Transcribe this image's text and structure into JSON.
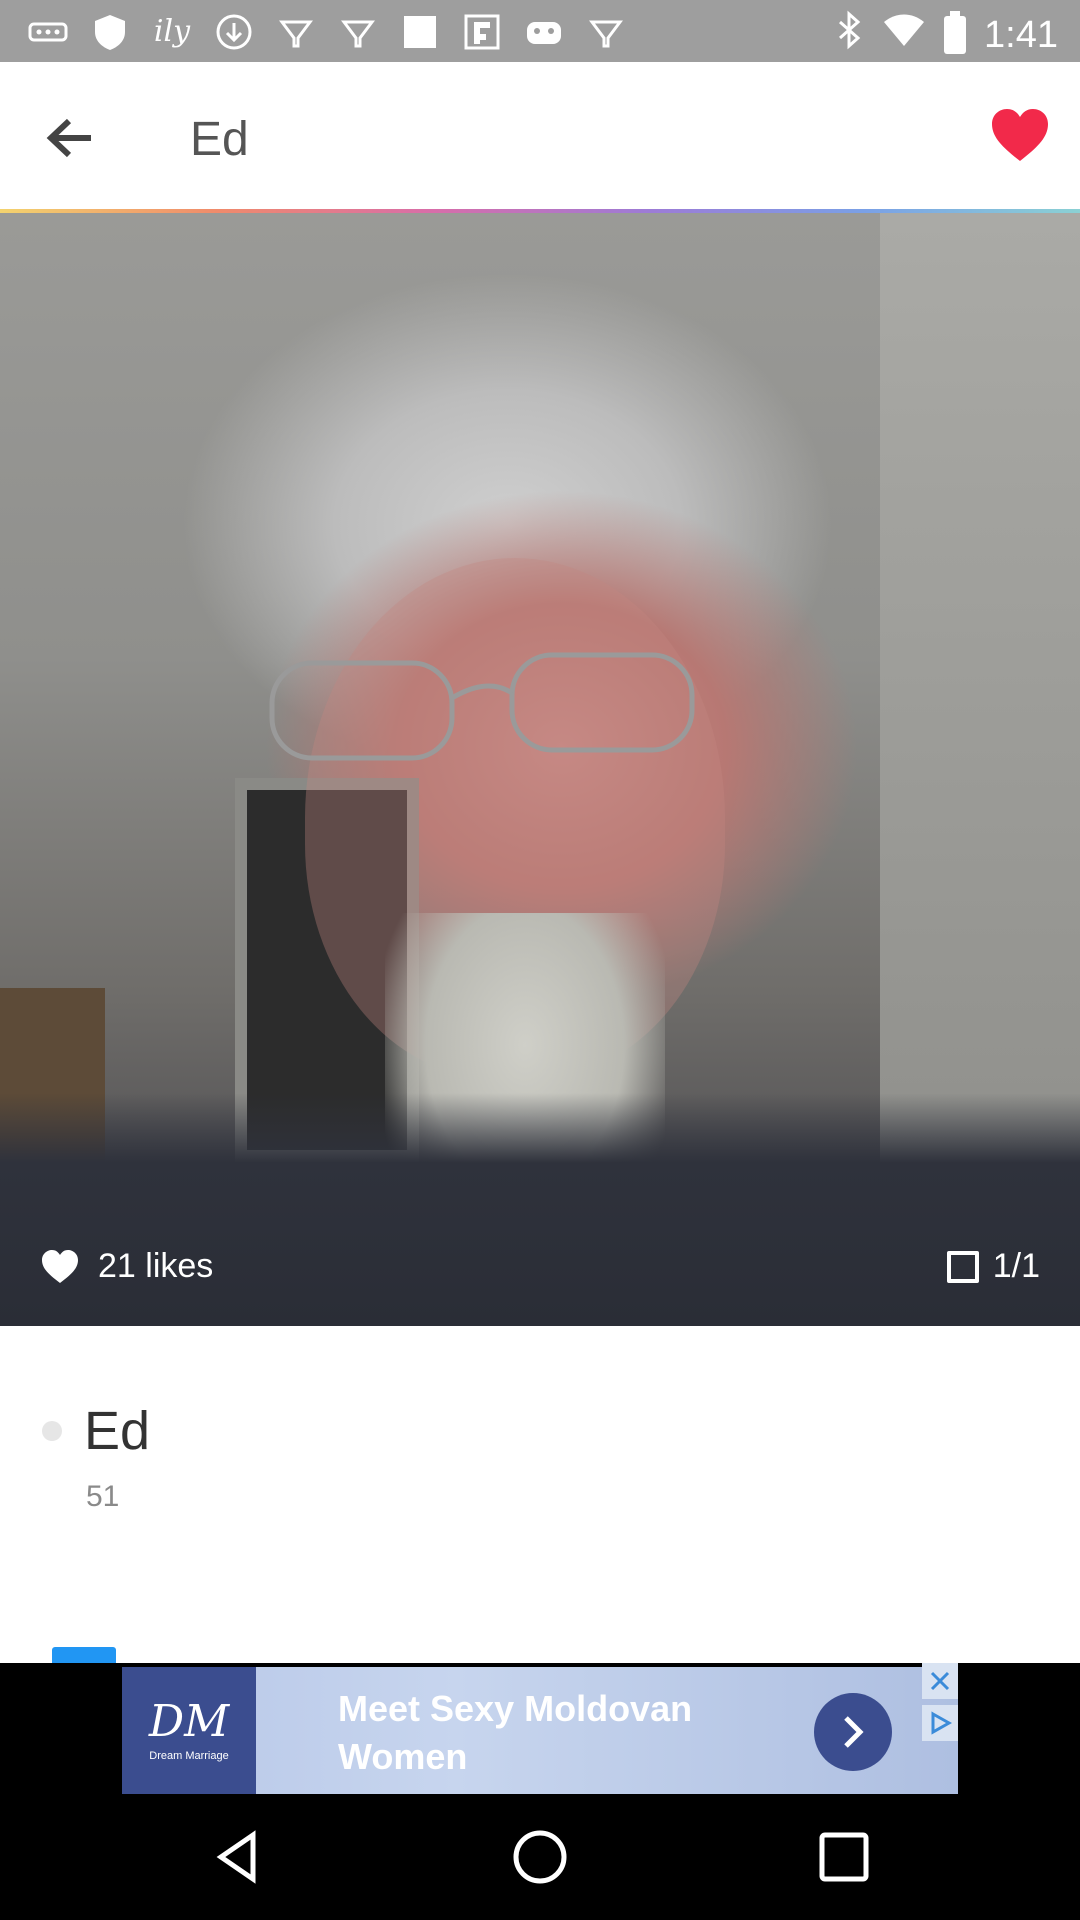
{
  "status_bar": {
    "time": "1:41",
    "icons": [
      "more-dots-icon",
      "shield-icon",
      "ily-icon",
      "download-icon",
      "lightbulb-icon",
      "lightbulb-icon",
      "square-icon",
      "flipboard-icon",
      "gamepad-icon",
      "lightbulb-icon",
      "bluetooth-icon",
      "wifi-icon",
      "battery-icon"
    ]
  },
  "header": {
    "title": "Ed",
    "back_icon": "arrow-back-icon",
    "like_icon": "heart-icon",
    "like_color": "#f2294a"
  },
  "photo": {
    "likes_label": "21 likes",
    "photo_count": "1/1"
  },
  "profile": {
    "name": "Ed",
    "age": "51"
  },
  "ad": {
    "brand": "Dream Marriage",
    "text": "Meet Sexy Moldovan Women",
    "accent": "#3b4d8f"
  },
  "nav": {
    "back": "back-triangle-icon",
    "home": "home-circle-icon",
    "recents": "recents-square-icon"
  }
}
